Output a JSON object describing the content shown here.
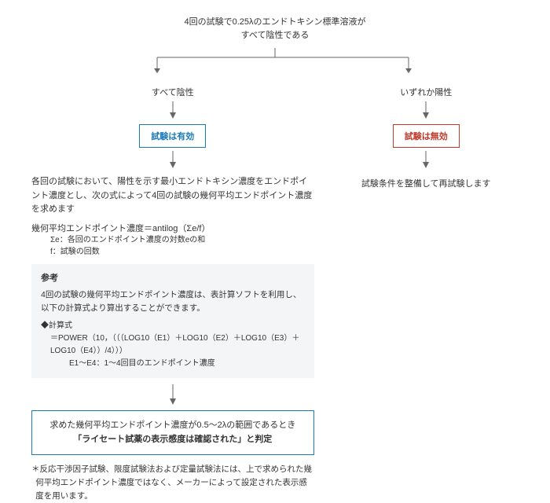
{
  "top": {
    "line1": "4回の試験で0.25λのエンドトキシン標準溶液が",
    "line2": "すべて陰性である"
  },
  "branches": {
    "left_label": "すべて陰性",
    "right_label": "いずれか陽性",
    "left_result": "試験は有効",
    "right_result": "試験は無効",
    "right_note": "試験条件を整備して再試験します"
  },
  "explain": {
    "p1": "各回の試験において、陽性を示す最小エンドトキシン濃度をエンドポイント濃度とし、次の式によって4回の試験の幾何平均エンドポイント濃度を求めます",
    "formula_main": "幾何平均エンドポイント濃度＝antilog（Σe/f）",
    "formula_sub1": "Σe：各回のエンドポイント濃度の対数eの和",
    "formula_sub2": "f：試験の回数"
  },
  "reference": {
    "title": "参考",
    "p1": "4回の試験の幾何平均エンドポイント濃度は、表計算ソフトを利用し、以下の計算式より算出することができます。",
    "calc_title": "◆計算式",
    "calc_line1": "＝POWER（10，（（（LOG10（E1）＋LOG10（E2）＋LOG10（E3）＋LOG10（E4））/4）））",
    "calc_line2": "E1～E4：1～4回目のエンドポイント濃度"
  },
  "judgment": {
    "line1": "求めた幾何平均エンドポイント濃度が0.5～2λの範囲であるとき",
    "line2": "「ライセート試薬の表示感度は確認された」と判定"
  },
  "footnote": {
    "text": "＊反応干渉因子試験、限度試験法および定量試験法には、上で求められた幾何平均エンドポイント濃度ではなく、メーカーによって設定された表示感度を用います。"
  }
}
